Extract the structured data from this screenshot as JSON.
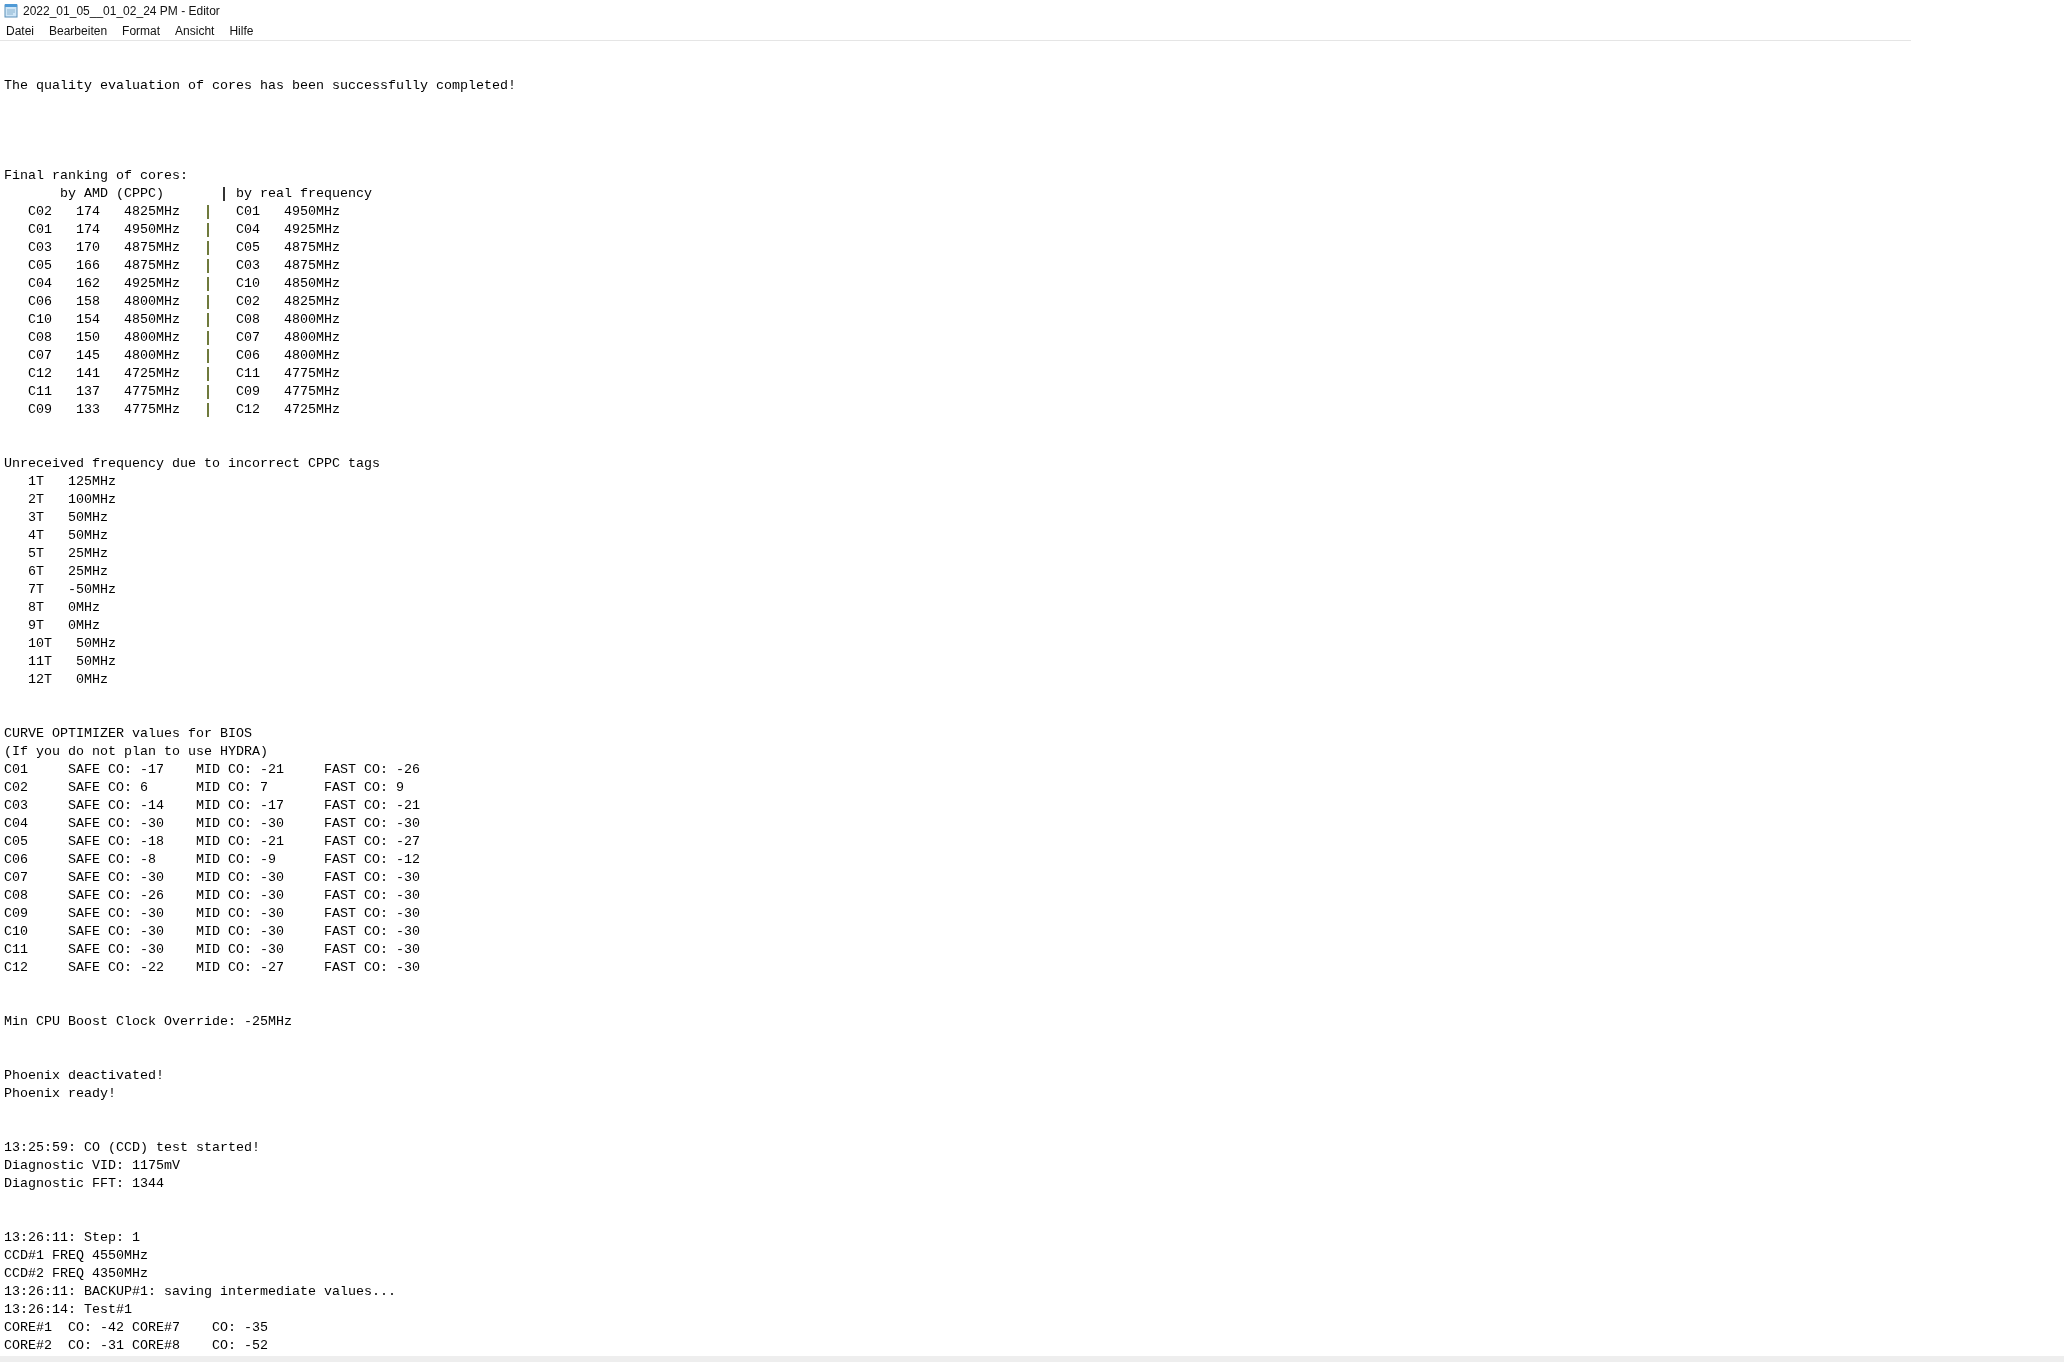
{
  "window": {
    "title": "2022_01_05__01_02_24 PM - Editor"
  },
  "menu": [
    "Datei",
    "Bearbeiten",
    "Format",
    "Ansicht",
    "Hilfe"
  ],
  "sections": [
    {
      "kind": "lines",
      "lines": [
        "The quality evaluation of cores has been successfully completed!"
      ]
    },
    {
      "kind": "ranking",
      "title": "Final ranking of cores:",
      "left_header": "by AMD (CPPC)",
      "right_header": "by real frequency",
      "rows": [
        {
          "amd": "C02   174   4825MHz",
          "real": "C01   4950MHz"
        },
        {
          "amd": "C01   174   4950MHz",
          "real": "C04   4925MHz"
        },
        {
          "amd": "C03   170   4875MHz",
          "real": "C05   4875MHz"
        },
        {
          "amd": "C05   166   4875MHz",
          "real": "C03   4875MHz"
        },
        {
          "amd": "C04   162   4925MHz",
          "real": "C10   4850MHz"
        },
        {
          "amd": "C06   158   4800MHz",
          "real": "C02   4825MHz"
        },
        {
          "amd": "C10   154   4850MHz",
          "real": "C08   4800MHz"
        },
        {
          "amd": "C08   150   4800MHz",
          "real": "C07   4800MHz"
        },
        {
          "amd": "C07   145   4800MHz",
          "real": "C06   4800MHz"
        },
        {
          "amd": "C12   141   4725MHz",
          "real": "C11   4775MHz"
        },
        {
          "amd": "C11   137   4775MHz",
          "real": "C09   4775MHz"
        },
        {
          "amd": "C09   133   4775MHz",
          "real": "C12   4725MHz"
        }
      ]
    },
    {
      "kind": "list",
      "title": "Unreceived frequency due to incorrect CPPC tags",
      "items": [
        "1T   125MHz",
        "2T   100MHz",
        "3T   50MHz",
        "4T   50MHz",
        "5T   25MHz",
        "6T   25MHz",
        "7T   -50MHz",
        "8T   0MHz",
        "9T   0MHz",
        "10T   50MHz",
        "11T   50MHz",
        "12T   0MHz"
      ]
    },
    {
      "kind": "curve",
      "lines": [
        "CURVE OPTIMIZER values for BIOS",
        "(If you do not plan to use HYDRA)"
      ],
      "rows": [
        {
          "core": "C01",
          "safe": "SAFE CO: -17",
          "mid": "MID CO: -21",
          "fast": "FAST CO: -26"
        },
        {
          "core": "C02",
          "safe": "SAFE CO: 6",
          "mid": "MID CO: 7",
          "fast": "FAST CO: 9"
        },
        {
          "core": "C03",
          "safe": "SAFE CO: -14",
          "mid": "MID CO: -17",
          "fast": "FAST CO: -21"
        },
        {
          "core": "C04",
          "safe": "SAFE CO: -30",
          "mid": "MID CO: -30",
          "fast": "FAST CO: -30"
        },
        {
          "core": "C05",
          "safe": "SAFE CO: -18",
          "mid": "MID CO: -21",
          "fast": "FAST CO: -27"
        },
        {
          "core": "C06",
          "safe": "SAFE CO: -8",
          "mid": "MID CO: -9",
          "fast": "FAST CO: -12"
        },
        {
          "core": "C07",
          "safe": "SAFE CO: -30",
          "mid": "MID CO: -30",
          "fast": "FAST CO: -30"
        },
        {
          "core": "C08",
          "safe": "SAFE CO: -26",
          "mid": "MID CO: -30",
          "fast": "FAST CO: -30"
        },
        {
          "core": "C09",
          "safe": "SAFE CO: -30",
          "mid": "MID CO: -30",
          "fast": "FAST CO: -30"
        },
        {
          "core": "C10",
          "safe": "SAFE CO: -30",
          "mid": "MID CO: -30",
          "fast": "FAST CO: -30"
        },
        {
          "core": "C11",
          "safe": "SAFE CO: -30",
          "mid": "MID CO: -30",
          "fast": "FAST CO: -30"
        },
        {
          "core": "C12",
          "safe": "SAFE CO: -22",
          "mid": "MID CO: -27",
          "fast": "FAST CO: -30"
        }
      ]
    },
    {
      "kind": "lines",
      "lines": [
        "Min CPU Boost Clock Override: -25MHz"
      ]
    },
    {
      "kind": "lines",
      "lines": [
        "Phoenix deactivated!",
        "Phoenix ready!"
      ]
    },
    {
      "kind": "lines",
      "lines": [
        "13:25:59: CO (CCD) test started!",
        "Diagnostic VID: 1175mV",
        "Diagnostic FFT: 1344"
      ]
    },
    {
      "kind": "lines",
      "lines": [
        "13:26:11: Step: 1",
        "CCD#1 FREQ 4550MHz",
        "CCD#2 FREQ 4350MHz",
        "13:26:11: BACKUP#1: saving intermediate values...",
        "13:26:14: Test#1",
        "CORE#1  CO: -42 CORE#7    CO: -35",
        "CORE#2  CO: -31 CORE#8    CO: -52"
      ]
    }
  ]
}
